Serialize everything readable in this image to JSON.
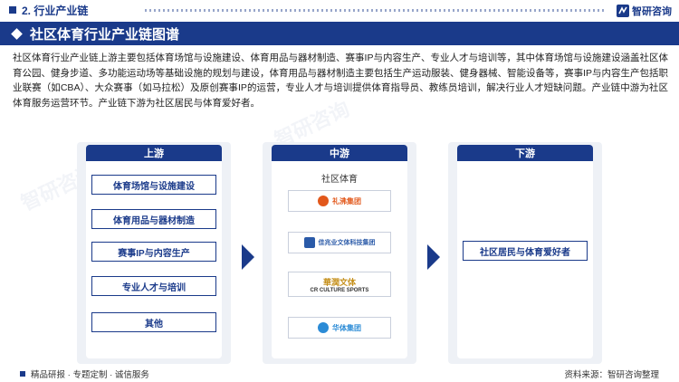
{
  "header": {
    "section_title": "2. 行业产业链",
    "brand_name": "智研咨询"
  },
  "banner": {
    "title": "社区体育行业产业链图谱"
  },
  "intro": {
    "text": "社区体育行业产业链上游主要包括体育场馆与设施建设、体育用品与器材制造、赛事IP与内容生产、专业人才与培训等，其中体育场馆与设施建设涵盖社区体育公园、健身步道、多功能运动场等基础设施的规划与建设，体育用品与器材制造主要包括生产运动服装、健身器械、智能设备等，赛事IP与内容生产包括职业联赛（如CBA）、大众赛事（如马拉松）及原创赛事IP的运营，专业人才与培训提供体育指导员、教练员培训，解决行业人才短缺问题。产业链中游为社区体育服务运营环节。产业链下游为社区居民与体育爱好者。"
  },
  "upstream": {
    "header": "上游",
    "items": [
      "体育场馆与设施建设",
      "体育用品与器材制造",
      "赛事IP与内容生产",
      "专业人才与培训",
      "其他"
    ]
  },
  "midstream": {
    "header": "中游",
    "label": "社区体育",
    "companies": [
      {
        "name": "礼沸集团",
        "color": "#e2581b"
      },
      {
        "name": "佳兆业文体科技集团",
        "color": "#2a5aa8"
      },
      {
        "name": "華潤文体",
        "sub": "CR CULTURE SPORTS",
        "color": "#c58f1a"
      },
      {
        "name": "华体集团",
        "color": "#2b8bd6"
      }
    ]
  },
  "downstream": {
    "header": "下游",
    "items": [
      "社区居民与体育爱好者"
    ]
  },
  "footer": {
    "left": "精品研报 · 专题定制 · 诚信服务",
    "source": "资料来源：智研咨询整理"
  },
  "watermark": "智研咨询"
}
